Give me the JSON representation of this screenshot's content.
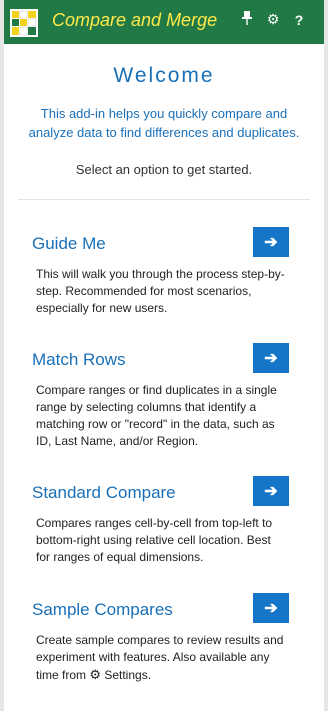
{
  "header": {
    "title": "Compare and Merge",
    "pin_icon": "pin-icon",
    "settings_icon": "gear-icon",
    "help_label": "?",
    "brand_color": "#217a45",
    "title_color": "#ffe84a"
  },
  "welcome": {
    "heading": "Welcome",
    "intro": "This add-in helps you quickly compare and analyze data to find differences and duplicates.",
    "prompt": "Select an option to get started."
  },
  "options": [
    {
      "title": "Guide Me",
      "description": "This will walk you through the process step-by-step. Recommended for most scenarios, especially for new users.",
      "button_icon": "arrow-right-icon"
    },
    {
      "title": "Match Rows",
      "description": "Compare ranges or find duplicates in a single range by selecting columns that identify a matching row or \"record\" in the data, such as ID, Last Name, and/or Region.",
      "button_icon": "arrow-right-icon"
    },
    {
      "title": "Standard Compare",
      "description": "Compares ranges cell-by-cell from top-left to bottom-right using relative cell location. Best for ranges of equal dimensions.",
      "button_icon": "arrow-right-icon"
    },
    {
      "title": "Sample Compares",
      "description_before": "Create sample compares to review results and experiment with features. Also available any time from ",
      "description_icon": "gear-icon",
      "description_after": " Settings.",
      "button_icon": "arrow-right-icon"
    }
  ],
  "colors": {
    "accent": "#1a70b8",
    "button": "#1475c9"
  }
}
